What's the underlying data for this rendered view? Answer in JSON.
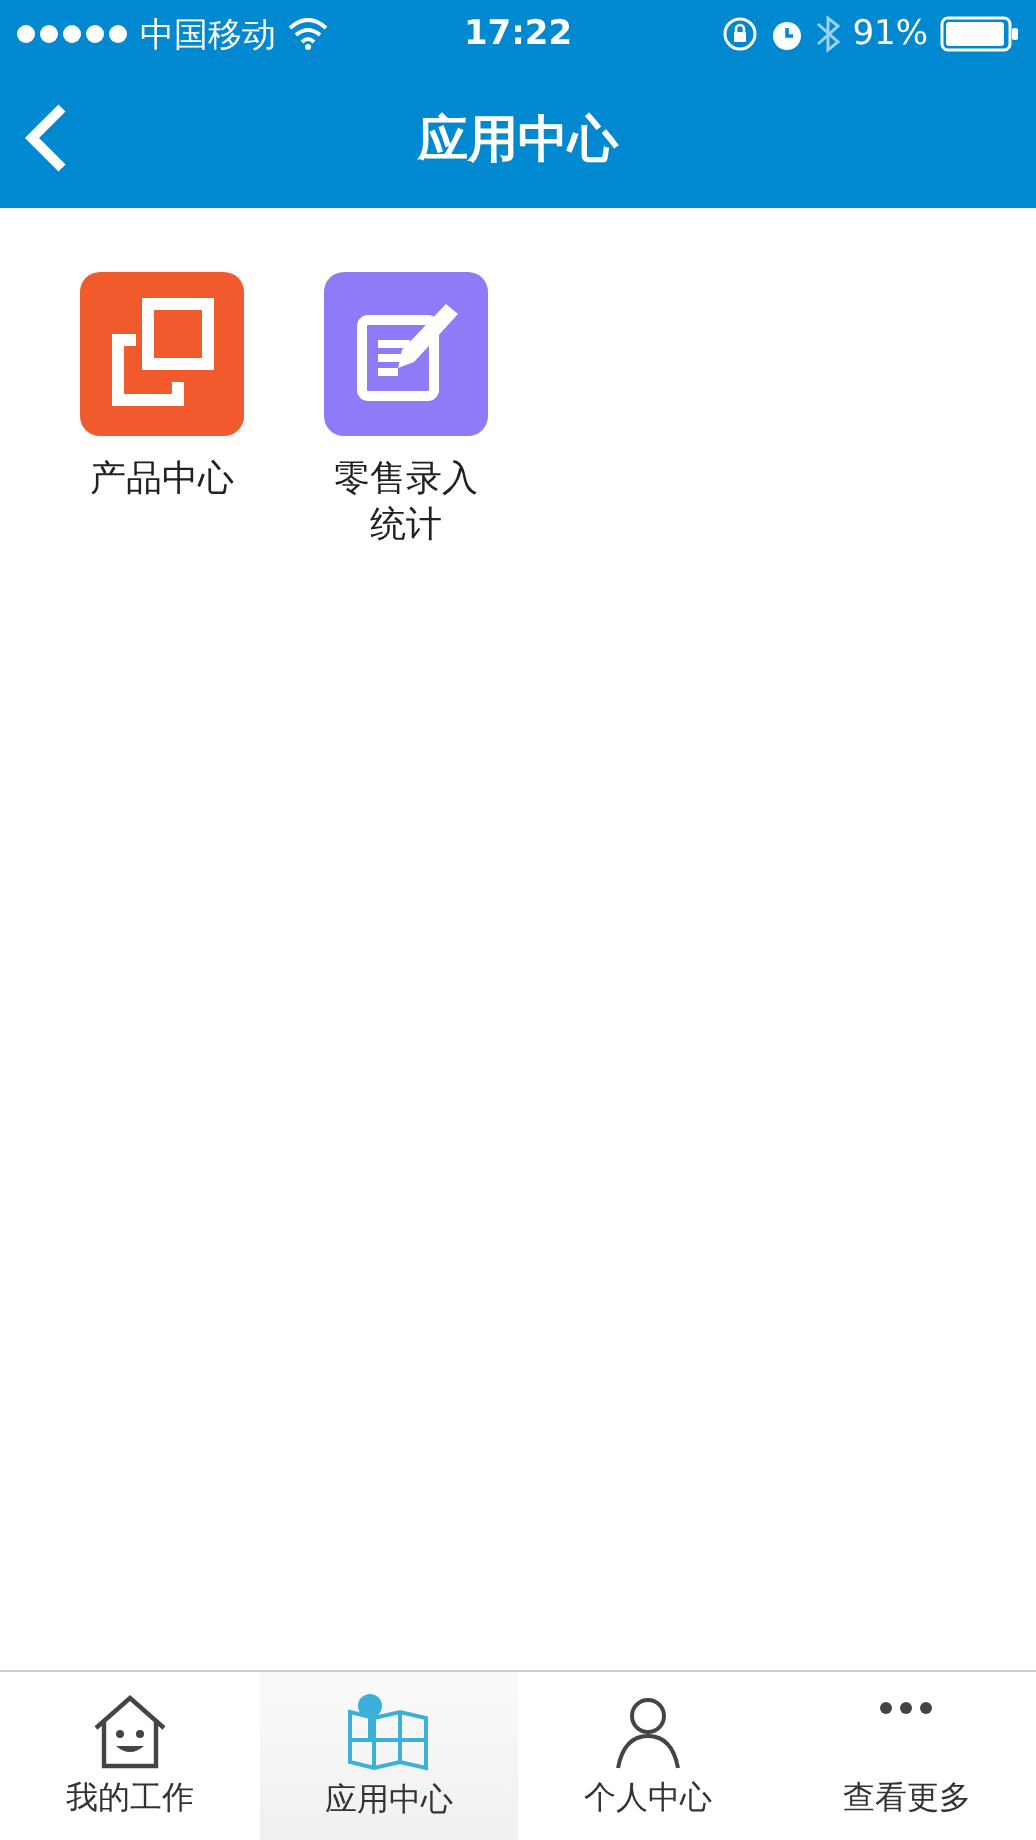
{
  "status_bar": {
    "carrier": "中国移动",
    "time": "17:22",
    "battery": "91%"
  },
  "nav_bar": {
    "title": "应用中心"
  },
  "apps": [
    {
      "label": "产品中心",
      "kind": "squares",
      "color": "#f05a2d"
    },
    {
      "label": "零售录入统计",
      "kind": "note",
      "color": "#8f7bf7"
    }
  ],
  "tab_bar": [
    {
      "label": "我的工作",
      "kind": "home",
      "selected": false
    },
    {
      "label": "应用中心",
      "kind": "map",
      "selected": true
    },
    {
      "label": "个人中心",
      "kind": "person",
      "selected": false
    },
    {
      "label": "查看更多",
      "kind": "more",
      "selected": false
    }
  ]
}
